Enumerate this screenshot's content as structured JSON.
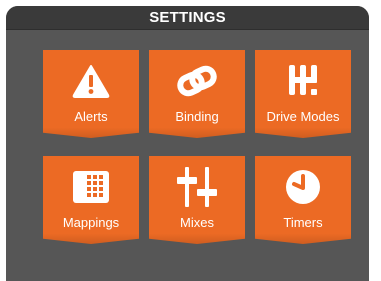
{
  "header": {
    "title": "SETTINGS"
  },
  "tiles": [
    {
      "label": "Alerts",
      "icon": "warning-icon"
    },
    {
      "label": "Binding",
      "icon": "link-icon"
    },
    {
      "label": "Drive Modes",
      "icon": "gear-shift-icon"
    },
    {
      "label": "Mappings",
      "icon": "grid-icon"
    },
    {
      "label": "Mixes",
      "icon": "sliders-icon"
    },
    {
      "label": "Timers",
      "icon": "clock-icon"
    }
  ],
  "colors": {
    "tile": "#ec6a24",
    "background": "#565656",
    "header": "#3a3a3a",
    "text": "#ffffff"
  }
}
